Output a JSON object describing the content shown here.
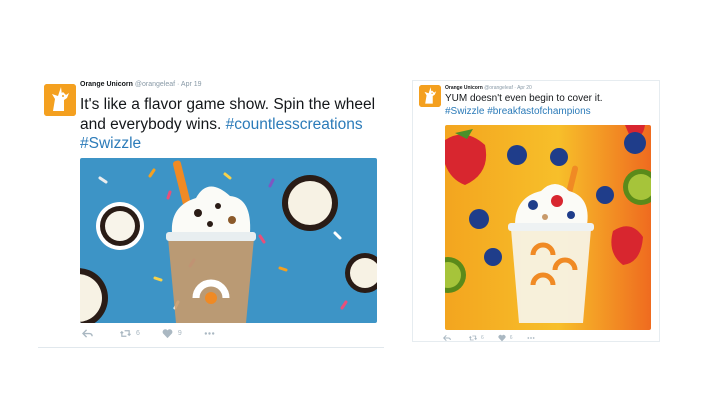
{
  "tweets": [
    {
      "author_name": "Orange Unicorn",
      "handle": "@orangeleaf",
      "separator": "·",
      "date": "Apr 19",
      "text": "It's like a flavor game show. Spin the wheel and everybody wins. ",
      "hashtags": [
        "#countlesscreations",
        "#Swizzle"
      ],
      "retweets": "6",
      "likes": "9",
      "media_theme": "blue background with cookies and sprinkles"
    },
    {
      "author_name": "Orange Unicorn",
      "handle": "@orangeleaf",
      "separator": "·",
      "date": "Apr 20",
      "text": "YUM doesn't even begin to cover it.",
      "hashtags": [
        "#Swizzle",
        "#breakfastofchampions"
      ],
      "retweets": "6",
      "likes": "6",
      "media_theme": "orange and yellow background with fruit"
    }
  ],
  "icons": {
    "reply": "reply-icon",
    "retweet": "retweet-icon",
    "like": "heart-icon",
    "more": "more-icon"
  },
  "colors": {
    "hashtag": "#2b7bb9",
    "avatar_bg": "#f4a01f",
    "media_a_bg": "#3d94c6",
    "media_b_left": "#f3a51f",
    "media_b_right": "#ef6b1f"
  }
}
